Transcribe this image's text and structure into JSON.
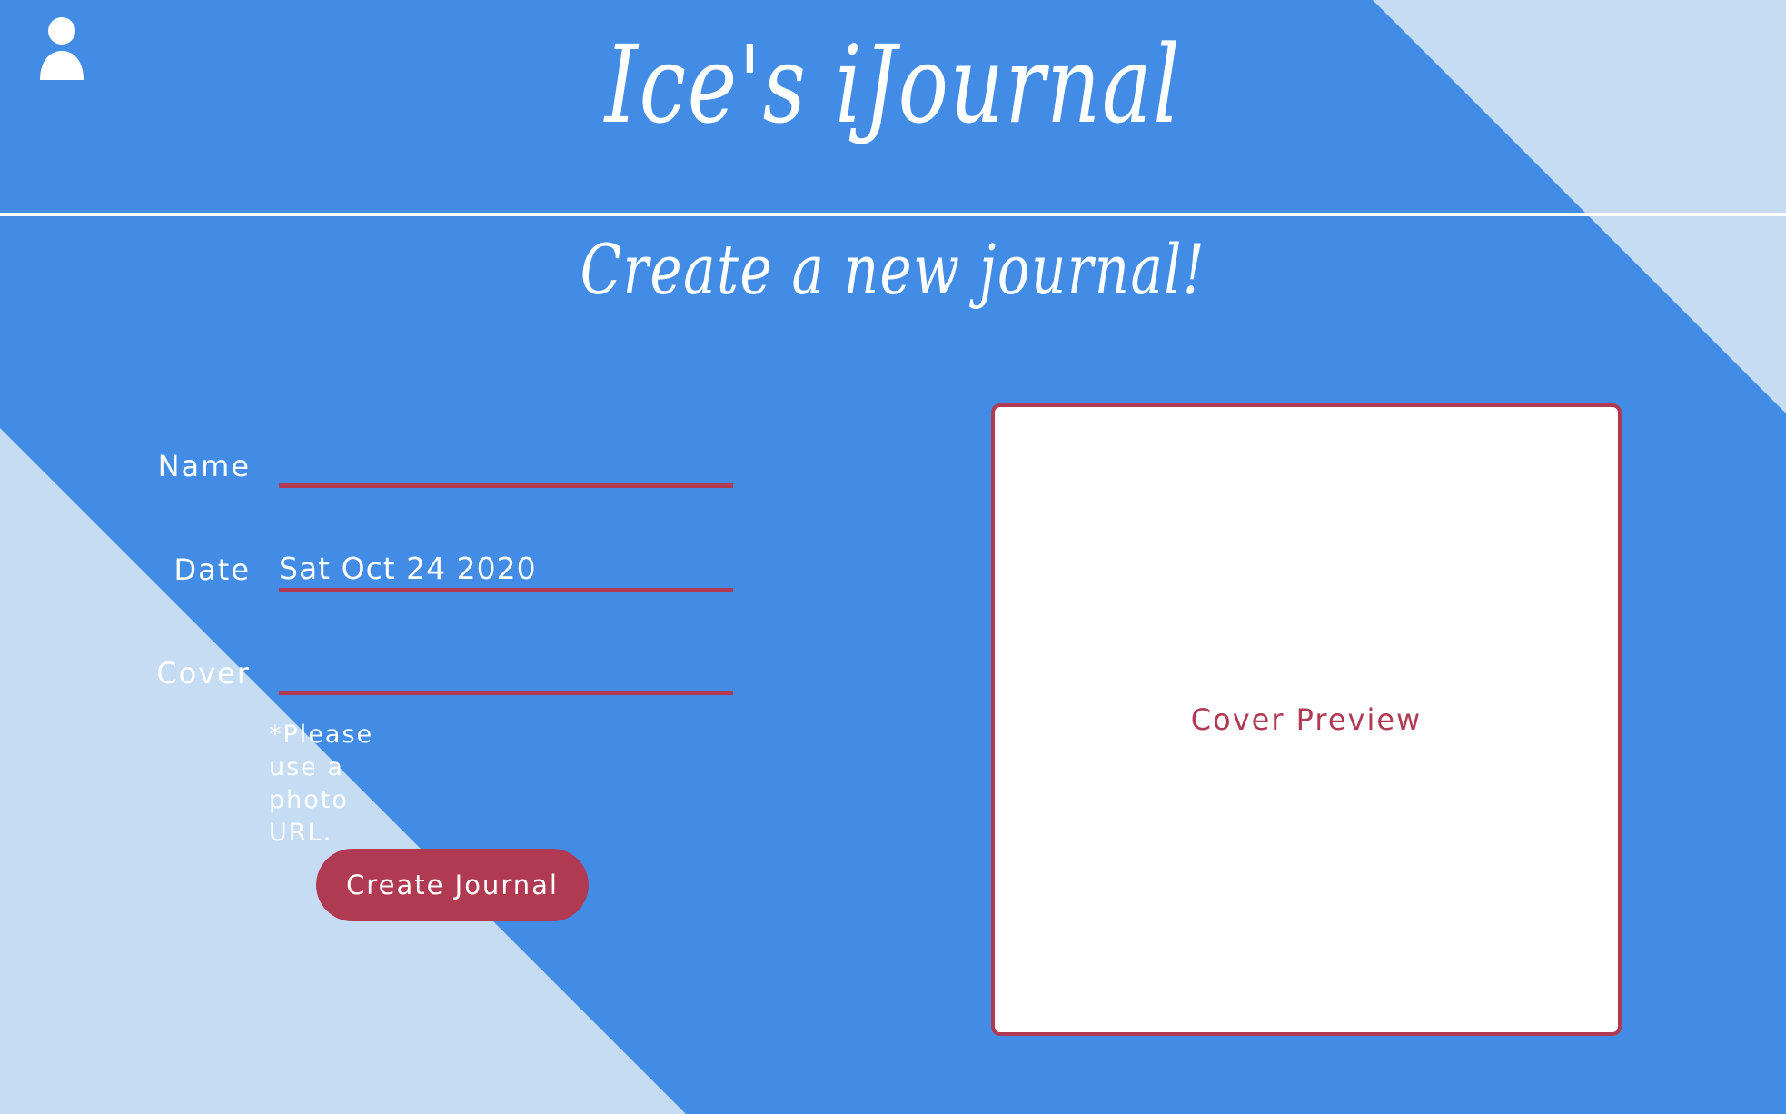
{
  "header": {
    "title": "Ice's iJournal",
    "user_icon": "user-icon"
  },
  "page": {
    "subtitle": "Create a new journal!"
  },
  "form": {
    "name_label": "Name",
    "name_value": "",
    "date_label": "Date",
    "date_value": "Sat Oct 24 2020",
    "cover_label": "Cover",
    "cover_value": "",
    "cover_hint": "*Please use a photo URL.",
    "submit_label": "Create Journal"
  },
  "preview": {
    "label": "Cover Preview"
  },
  "colors": {
    "background": "#428ce6",
    "light_panel": "#c5dcf3",
    "accent": "#b03a52",
    "text": "#ffffff"
  }
}
